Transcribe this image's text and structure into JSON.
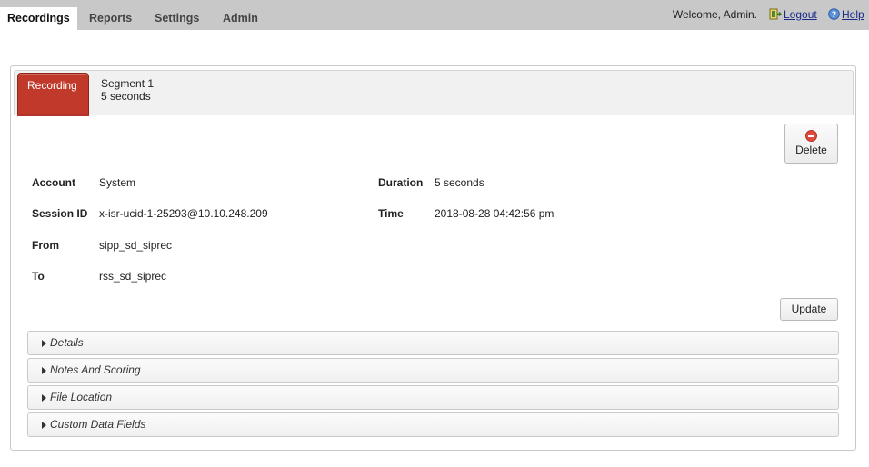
{
  "nav": {
    "tabs": [
      {
        "label": "Recordings",
        "active": true
      },
      {
        "label": "Reports"
      },
      {
        "label": "Settings"
      },
      {
        "label": "Admin"
      }
    ],
    "welcome": "Welcome, Admin.",
    "logout": "Logout",
    "help": "Help"
  },
  "segments": {
    "recording_tab": "Recording",
    "segment_title": "Segment 1",
    "segment_duration": "5 seconds"
  },
  "actions": {
    "delete": "Delete",
    "update": "Update"
  },
  "fields": {
    "account_label": "Account",
    "account_value": "System",
    "session_label": "Session ID",
    "session_value": "x-isr-ucid-1-25293@10.10.248.209",
    "from_label": "From",
    "from_value": "sipp_sd_siprec",
    "to_label": "To",
    "to_value": "rss_sd_siprec",
    "duration_label": "Duration",
    "duration_value": "5 seconds",
    "time_label": "Time",
    "time_value": "2018-08-28 04:42:56 pm"
  },
  "sections": [
    {
      "label": "Details"
    },
    {
      "label": "Notes And Scoring"
    },
    {
      "label": "File Location"
    },
    {
      "label": "Custom Data Fields"
    }
  ],
  "colors": {
    "topbar": "#c8c8c8",
    "recording_tab": "#c0392b",
    "link": "#1a2a88"
  },
  "icons": {
    "logout": "logout-icon",
    "help": "help-icon",
    "delete": "delete-icon",
    "caret": "caret-right-icon"
  }
}
